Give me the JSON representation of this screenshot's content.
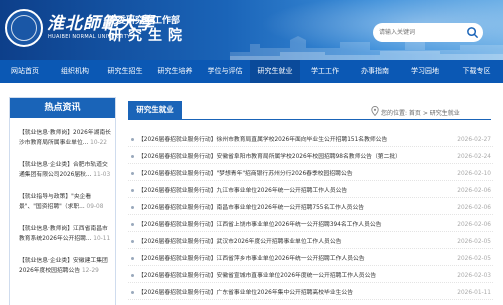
{
  "header": {
    "brand_cn": "淮北師範大學",
    "brand_en": "HUAIBEI NORMAL UNIVERSITY",
    "title_sub": "党委研究生工作部",
    "title_main": "研究生院",
    "search": {
      "placeholder": "请输入关键词"
    },
    "colors": {
      "primary": "#1a64b8",
      "nav": "#0b58b4"
    }
  },
  "nav": {
    "items": [
      {
        "label": "网站首页"
      },
      {
        "label": "组织机构"
      },
      {
        "label": "研究生招生"
      },
      {
        "label": "研究生培养"
      },
      {
        "label": "学位与评估"
      },
      {
        "label": "研究生就业",
        "active": true
      },
      {
        "label": "学工工作"
      },
      {
        "label": "办事指南"
      },
      {
        "label": "学习园地"
      },
      {
        "label": "下载专区"
      }
    ]
  },
  "sidebar": {
    "title": "热点资讯",
    "items": [
      {
        "text": "【就业信息·教师岗】2026年湖南长沙市教育局所属事业单位...",
        "date": "10-22"
      },
      {
        "text": "【就业信息·企业类】合肥市轨道交通集团有限公司2026届秋...",
        "date": "11-03"
      },
      {
        "text": "【就业指导与政策】\"央企看景\"、\"国资招聘\"（求职...",
        "date": "09-08"
      },
      {
        "text": "【就业信息·教师岗】江西省南昌市教育系统2026年公开招聘...",
        "date": "10-11"
      },
      {
        "text": "【就业信息·企业类】安徽建工集团2026年度校园招聘公告",
        "date": "12-29"
      }
    ]
  },
  "content": {
    "tab": "研究生就业",
    "breadcrumb": "您的位置: 首页 > 研究生就业",
    "rows": [
      {
        "title": "【2026届春招就业服务行动】徐州市教育局直属学校2026年面向毕业生公开招聘151名教师公告",
        "date": "2026-02-27"
      },
      {
        "title": "【2026届春招就业服务行动】安徽省阜阳市教育局所属学校2026年校园招聘98名教师公告（第二批）",
        "date": "2026-02-24"
      },
      {
        "title": "【2026届春招就业服务行动】\"梦想青年\"招商银行苏州分行2026春季校园招聘公告",
        "date": "2026-02-10"
      },
      {
        "title": "【2026届春招就业服务行动】九江市事业单位2026年统一公开招聘工作人员公告",
        "date": "2026-02-06"
      },
      {
        "title": "【2026届春招就业服务行动】南昌市事业单位2026年统一公开招聘755名工作人员公告",
        "date": "2026-02-06"
      },
      {
        "title": "【2026届春招就业服务行动】江西省上饶市事业单位2026年统一公开招聘394名工作人员公告",
        "date": "2026-02-06"
      },
      {
        "title": "【2026届春招就业服务行动】武汉市2026年度公开招聘事业单位工作人员公告",
        "date": "2026-02-05"
      },
      {
        "title": "【2026届春招就业服务行动】江西省萍乡市事业单位2026年统一公开招聘工作人员公告",
        "date": "2026-02-05"
      },
      {
        "title": "【2026届春招就业服务行动】安徽省宣城市直事业单位2026年度统一公开招聘工作人员公告",
        "date": "2026-02-03"
      },
      {
        "title": "【2026届春招就业服务行动】广东省事业单位2026年集中公开招聘高校毕业生公告",
        "date": "2026-01-11"
      }
    ]
  }
}
